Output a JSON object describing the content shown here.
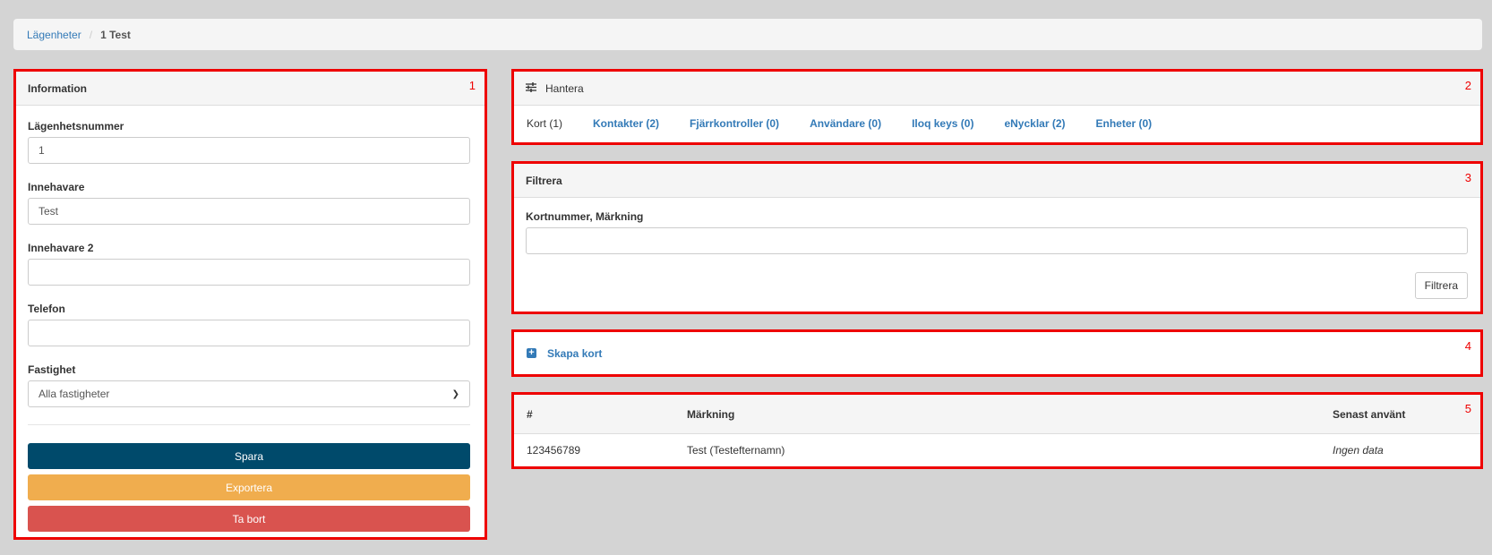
{
  "breadcrumb": {
    "parent": "Lägenheter",
    "separator": "/",
    "current": "1 Test"
  },
  "info_panel": {
    "number": "1",
    "title": "Information",
    "fields": {
      "apartment_number": {
        "label": "Lägenhetsnummer",
        "value": "1"
      },
      "owner": {
        "label": "Innehavare",
        "value": "Test"
      },
      "owner2": {
        "label": "Innehavare 2",
        "value": ""
      },
      "phone": {
        "label": "Telefon",
        "value": ""
      },
      "property": {
        "label": "Fastighet",
        "selected": "Alla fastigheter"
      }
    },
    "buttons": {
      "save": "Spara",
      "export": "Exportera",
      "delete": "Ta bort"
    }
  },
  "manage_panel": {
    "number": "2",
    "title": "Hantera",
    "tabs": [
      {
        "label": "Kort (1)",
        "active": true
      },
      {
        "label": "Kontakter (2)",
        "active": false
      },
      {
        "label": "Fjärrkontroller (0)",
        "active": false
      },
      {
        "label": "Användare (0)",
        "active": false
      },
      {
        "label": "Iloq keys (0)",
        "active": false
      },
      {
        "label": "eNycklar (2)",
        "active": false
      },
      {
        "label": "Enheter (0)",
        "active": false
      }
    ]
  },
  "filter_panel": {
    "number": "3",
    "title": "Filtrera",
    "label": "Kortnummer, Märkning",
    "value": "",
    "button": "Filtrera"
  },
  "create_panel": {
    "number": "4",
    "link": "Skapa kort"
  },
  "table_panel": {
    "number": "5",
    "columns": [
      "#",
      "Märkning",
      "Senast använt"
    ],
    "rows": [
      {
        "id": "123456789",
        "label": "Test (Testefternamn)",
        "last_used": "Ingen data"
      }
    ]
  },
  "colors": {
    "annotation_red": "#ee0000",
    "link_blue": "#337ab7",
    "primary": "#004a6b",
    "warning": "#f0ad4e",
    "danger": "#d9534f"
  }
}
